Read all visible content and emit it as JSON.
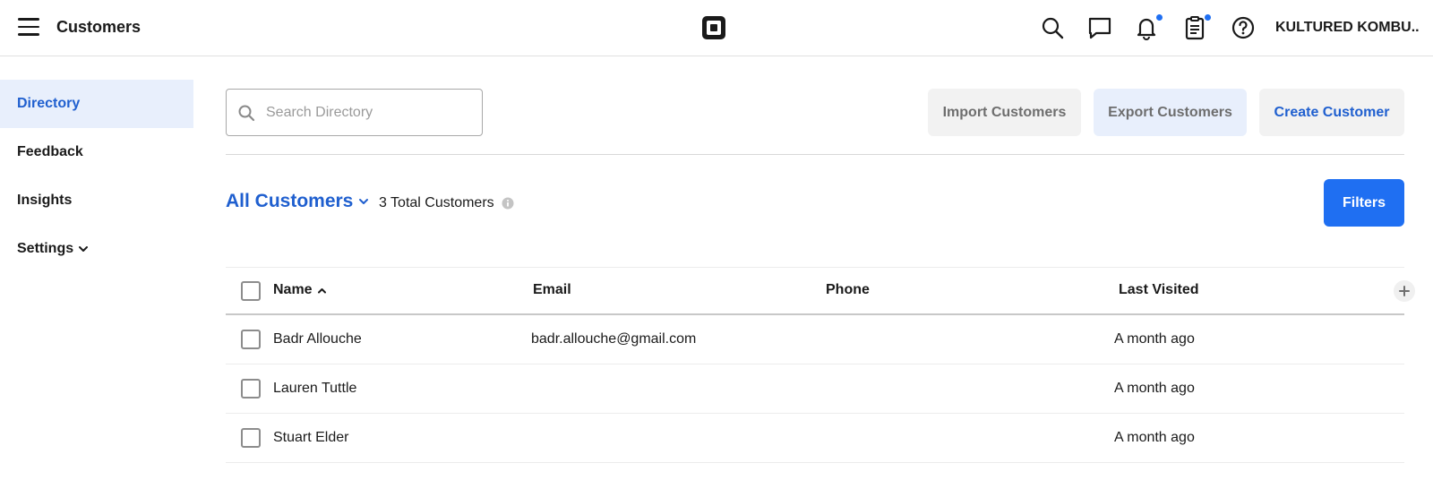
{
  "header": {
    "title": "Customers",
    "account_name": "KULTURED KOMBU...",
    "icons": [
      "menu-icon",
      "square-logo-icon",
      "search-icon",
      "messages-icon",
      "notifications-icon",
      "clipboard-icon",
      "help-icon"
    ],
    "accent_color": "#1f6ff2"
  },
  "sidebar": {
    "items": [
      {
        "label": "Directory",
        "active": true
      },
      {
        "label": "Feedback",
        "active": false
      },
      {
        "label": "Insights",
        "active": false
      },
      {
        "label": "Settings",
        "active": false
      }
    ]
  },
  "toolbar": {
    "search_placeholder": "Search Directory",
    "import_label": "Import Customers",
    "export_label": "Export Customers",
    "create_label": "Create Customer"
  },
  "filter_bar": {
    "group_label": "All Customers",
    "total_label": "3 Total Customers",
    "filters_label": "Filters"
  },
  "table": {
    "columns": [
      "Name",
      "Email",
      "Phone",
      "Last Visited"
    ],
    "rows": [
      {
        "name": "Badr Allouche",
        "email": "badr.allouche@gmail.com",
        "phone": "",
        "last_visited": "A month ago"
      },
      {
        "name": "Lauren Tuttle",
        "email": "",
        "phone": "",
        "last_visited": "A month ago"
      },
      {
        "name": "Stuart Elder",
        "email": "",
        "phone": "",
        "last_visited": "A month ago"
      }
    ]
  }
}
